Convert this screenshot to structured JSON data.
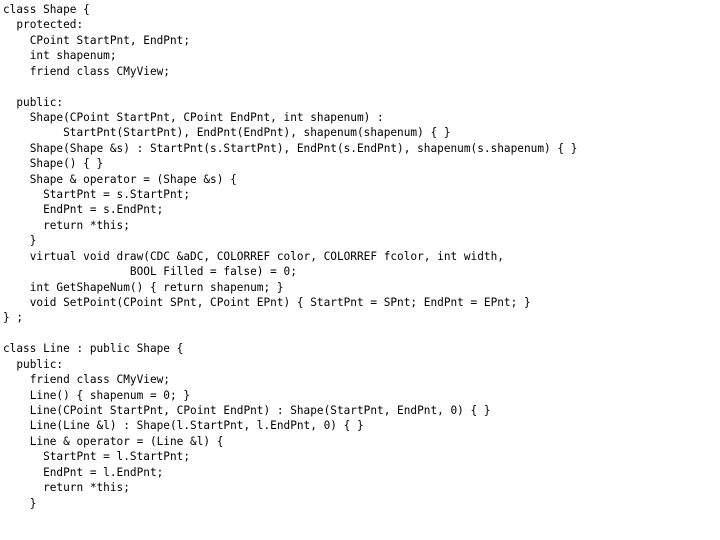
{
  "document": {
    "type": "source-code-listing",
    "language": "C++",
    "background_color": "#ffffff",
    "text_color": "#000000",
    "lines": [
      "class Shape {",
      "  protected:",
      "    CPoint StartPnt, EndPnt;",
      "    int shapenum;",
      "    friend class CMyView;",
      "",
      "  public:",
      "    Shape(CPoint StartPnt, CPoint EndPnt, int shapenum) :",
      "         StartPnt(StartPnt), EndPnt(EndPnt), shapenum(shapenum) { }",
      "    Shape(Shape &s) : StartPnt(s.StartPnt), EndPnt(s.EndPnt), shapenum(s.shapenum) { }",
      "    Shape() { }",
      "    Shape & operator = (Shape &s) {",
      "      StartPnt = s.StartPnt;",
      "      EndPnt = s.EndPnt;",
      "      return *this;",
      "    }",
      "    virtual void draw(CDC &aDC, COLORREF color, COLORREF fcolor, int width,",
      "                   BOOL Filled = false) = 0;",
      "    int GetShapeNum() { return shapenum; }",
      "    void SetPoint(CPoint SPnt, CPoint EPnt) { StartPnt = SPnt; EndPnt = EPnt; }",
      "} ;",
      "",
      "class Line : public Shape {",
      "  public:",
      "    friend class CMyView;",
      "    Line() { shapenum = 0; }",
      "    Line(CPoint StartPnt, CPoint EndPnt) : Shape(StartPnt, EndPnt, 0) { }",
      "    Line(Line &l) : Shape(l.StartPnt, l.EndPnt, 0) { }",
      "    Line & operator = (Line &l) {",
      "      StartPnt = l.StartPnt;",
      "      EndPnt = l.EndPnt;",
      "      return *this;",
      "    }"
    ]
  }
}
